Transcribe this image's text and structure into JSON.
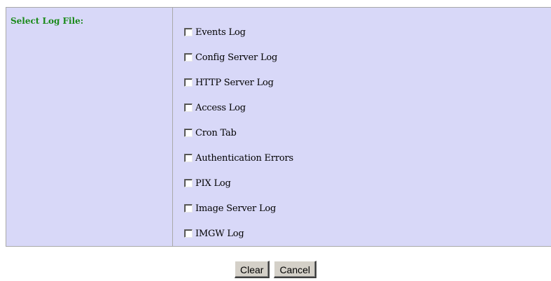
{
  "form": {
    "label": "Select Log File:",
    "options": [
      {
        "label": "Events Log",
        "checked": false
      },
      {
        "label": "Config Server Log",
        "checked": false
      },
      {
        "label": "HTTP Server Log",
        "checked": false
      },
      {
        "label": "Access Log",
        "checked": false
      },
      {
        "label": "Cron Tab",
        "checked": false
      },
      {
        "label": "Authentication Errors",
        "checked": false
      },
      {
        "label": "PIX Log",
        "checked": false
      },
      {
        "label": "Image Server Log",
        "checked": false
      },
      {
        "label": "IMGW Log",
        "checked": false
      }
    ]
  },
  "buttons": {
    "clear_label": "Clear",
    "cancel_label": "Cancel"
  },
  "colors": {
    "panel_background": "#d8d8f8",
    "label_text": "#1a8a1a",
    "button_face": "#d4d0c8"
  }
}
